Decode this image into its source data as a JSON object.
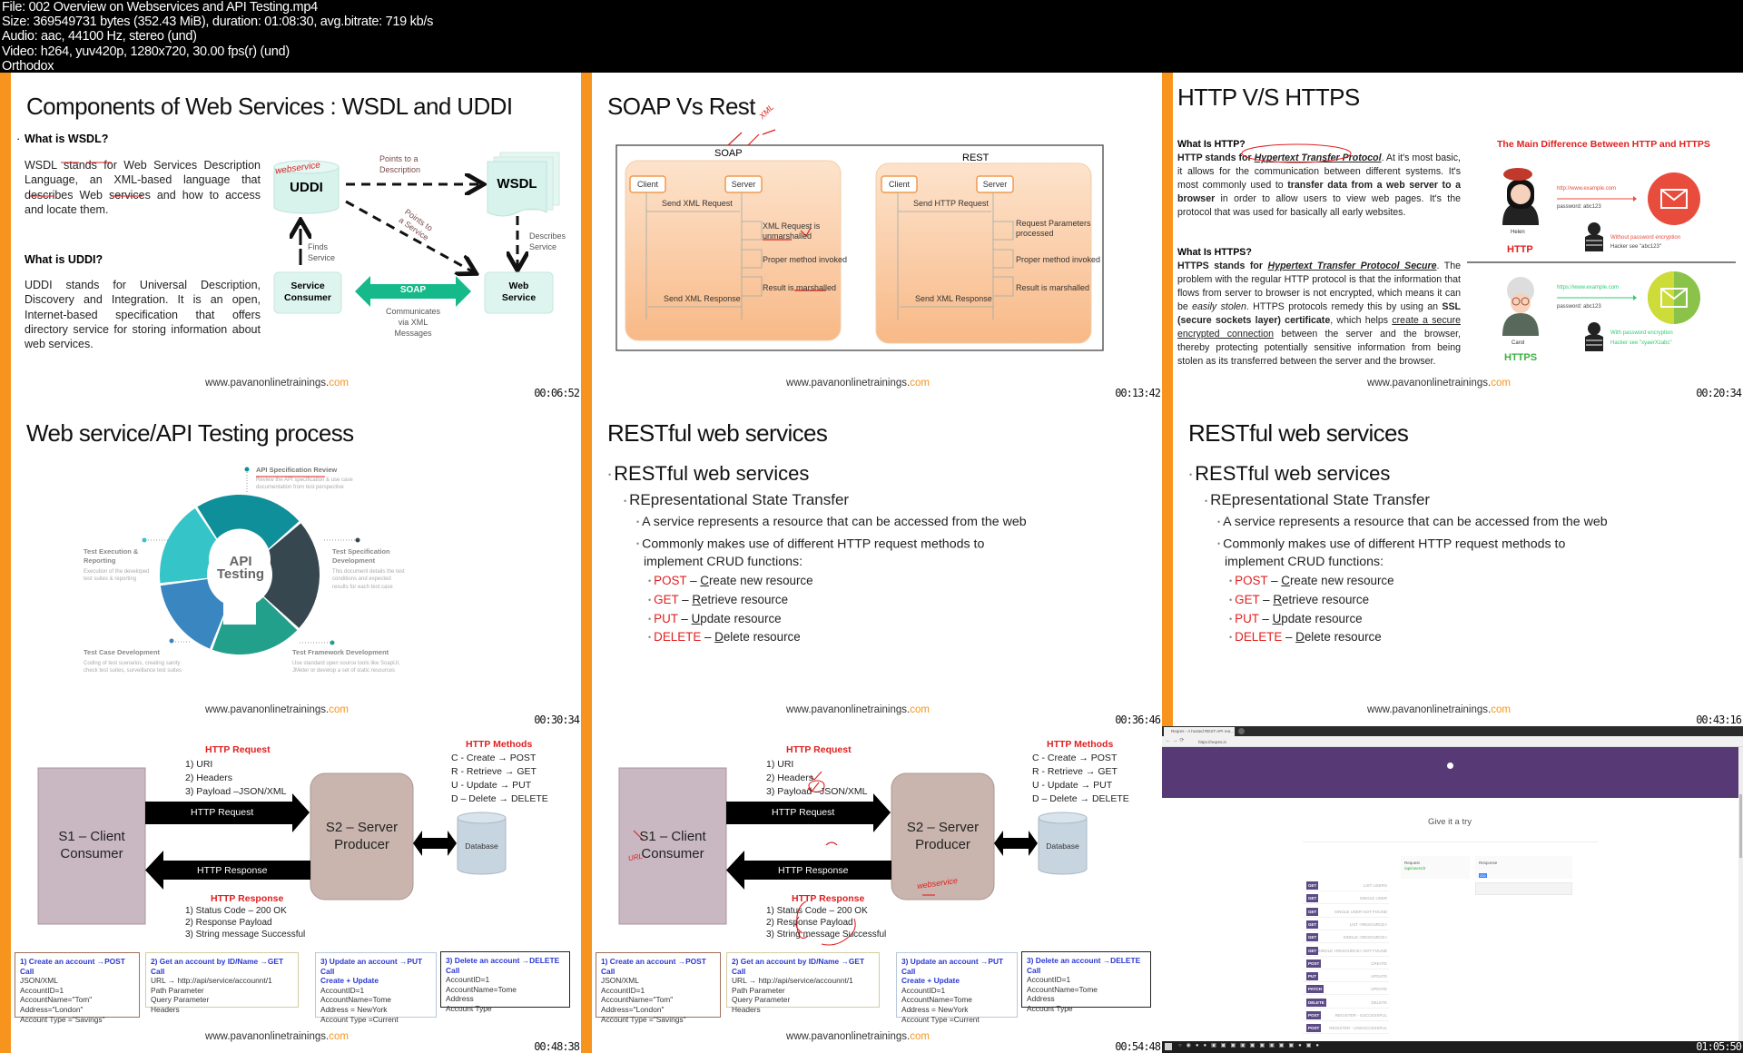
{
  "header": {
    "lines": [
      "File: 002 Overview on Webservices and API Testing.mp4",
      "Size: 369549731 bytes (352.43 MiB), duration: 01:08:30, avg.bitrate: 719 kb/s",
      "Audio: aac, 44100 Hz, stereo (und)",
      "Video: h264, yuv420p, 1280x720, 30.00 fps(r) (und)",
      "Orthodox"
    ]
  },
  "colors": {
    "accent_bar": "#f7941d",
    "method_red": "#e02020",
    "reqres_purple": "#573a75"
  },
  "footer_url": {
    "main": "www.pavanonlinetrainings.",
    "tld": "com"
  },
  "tiles": {
    "wsdl": {
      "timestamp": "00:06:52",
      "title": "Components of Web Services : WSDL and UDDI",
      "q1": "What is WSDL?",
      "a1": "WSDL stands for Web Services Description Language, an XML-based language that describes Web services and how to access and locate them.",
      "q2": "What is UDDI?",
      "a2": "UDDI stands for Universal Description, Discovery and Integration. It is an open, Internet-based specification that offers directory service for storing information about web services.",
      "uddi": "UDDI",
      "wsdl_label": "WSDL",
      "points_desc": [
        "Points to a",
        "Description"
      ],
      "points_service": [
        "Points to",
        "a Service"
      ],
      "finds": [
        "Finds",
        "Service"
      ],
      "describes": [
        "Describes",
        "Service"
      ],
      "consumer": [
        "Service",
        "Consumer"
      ],
      "soap": "SOAP",
      "communicates": [
        "Communicates",
        "via XML",
        "Messages"
      ],
      "web_service": [
        "Web",
        "Service"
      ],
      "handwriting": "webservice"
    },
    "soap_rest": {
      "timestamp": "00:13:42",
      "title": "SOAP Vs Rest",
      "soap": {
        "label": "SOAP",
        "client": "Client",
        "server": "Server",
        "req": "Send XML Request",
        "step1": [
          "XML Request is",
          "unmarshalled"
        ],
        "step2": "Proper method invoked",
        "step3": "Result is marshalled",
        "resp": "Send XML Response"
      },
      "rest": {
        "label": "REST",
        "client": "Client",
        "server": "Server",
        "req": "Send HTTP Request",
        "step1": [
          "Request Parameters",
          "processed"
        ],
        "step2": "Proper method invoked",
        "step3": "Result is marshalled",
        "resp": "Send XML Response"
      },
      "handwriting": "XML"
    },
    "http_https": {
      "timestamp": "00:20:34",
      "title": "HTTP V/S HTTPS",
      "q1": "What Is HTTP?",
      "p1": [
        "HTTP stands for ",
        "Hypertext Transfer Protocol",
        ". At it's most basic, it allows for the communication between different systems. It's most commonly used to ",
        "transfer data from a web server to a browser",
        " in order to allow users to view web pages. It's the protocol that was used for basically all early websites."
      ],
      "q2": "What Is HTTPS?",
      "p2": [
        "HTTPS stands for ",
        "Hypertext Transfer Protocol Secure",
        ". The problem with the regular HTTP protocol is that the information that flows from server to browser is not encrypted, which means it can be ",
        "easily stolen",
        ". HTTPS protocols remedy this by using an ",
        "SSL (secure sockets layer) certificate",
        ", which helps ",
        "create a secure encrypted connection",
        " between the server and the browser, thereby protecting potentially sensitive information from being stolen as its transferred between the server and the browser."
      ],
      "fig_title": "The Main Difference Between HTTP and HTTPS",
      "http": {
        "person": "Helen",
        "label": "HTTP",
        "url": "http://www.example.com",
        "password": "password: abc123",
        "note": "Without password encryption",
        "hacker": "Hacker see \"abc123\""
      },
      "https": {
        "person": "Carol",
        "label": "HTTPS",
        "url": "https://www.example.com",
        "password": "password: abc123",
        "note": "With password encryption",
        "hacker": "Hacker see \"xyaerXzabc\""
      }
    },
    "api_process": {
      "timestamp": "00:30:34",
      "title": "Web service/API Testing process",
      "center": [
        "API",
        "Testing"
      ],
      "steps": [
        {
          "name": "API Specification Review",
          "desc": [
            "Review the API specification & use case",
            "documentation from test perspective"
          ]
        },
        {
          "name": "Test Specification Development",
          "desc": [
            "This document details the test",
            "conditions and expected",
            "results for each test case"
          ]
        },
        {
          "name": "Test Framework Development",
          "desc": [
            "Use standard open source tools like SoapUI,",
            "JMeter or develop a set of static resources"
          ]
        },
        {
          "name": "Test Case Development",
          "desc": [
            "Coding of test scenarios, creating sanity",
            "check test suites, surveillance test suites"
          ]
        },
        {
          "name": "Test Execution & Reporting",
          "desc": [
            "Execution of the developed",
            "test suites & reporting"
          ]
        }
      ],
      "segment_colors": [
        "#0f8f9a",
        "#37474f",
        "#22a08b",
        "#3a86c0",
        "#35c4c8"
      ]
    },
    "restful_1": {
      "timestamp": "00:36:46",
      "title": "RESTful web services",
      "l1": "RESTful web services",
      "l2": "REpresentational State Transfer",
      "l3a": "A service represents a resource that can be accessed from the web",
      "l3b": [
        "Commonly makes use of different HTTP request methods to",
        "implement CRUD functions:"
      ],
      "methods": [
        {
          "method": "POST",
          "desc": "Create new resource"
        },
        {
          "method": "GET",
          "desc": "Retrieve resource"
        },
        {
          "method": "PUT",
          "desc": "Update resource"
        },
        {
          "method": "DELETE",
          "desc": "Delete resource"
        }
      ]
    },
    "restful_2": {
      "timestamp": "00:43:16",
      "title": "RESTful web services",
      "l1": "RESTful web services",
      "l2": "REpresentational State Transfer",
      "l3a": "A service represents a resource that can be accessed from the web",
      "l3b": [
        "Commonly makes use of different HTTP request methods to",
        "implement CRUD functions:"
      ],
      "methods": [
        {
          "method": "POST",
          "desc": "Create new resource"
        },
        {
          "method": "GET",
          "desc": "Retrieve resource"
        },
        {
          "method": "PUT",
          "desc": "Update resource"
        },
        {
          "method": "DELETE",
          "desc": "Delete resource"
        }
      ]
    },
    "http_flow_1": {
      "timestamp": "00:48:38",
      "client": [
        "S1 – Client",
        "Consumer"
      ],
      "server": [
        "S2 – Server",
        "Producer"
      ],
      "req_title": "HTTP Request",
      "req_items": [
        "1) URI",
        "2) Headers",
        "3) Payload –JSON/XML"
      ],
      "req_arrow": "HTTP Request",
      "resp_arrow": "HTTP Response",
      "resp_title": "HTTP Response",
      "resp_items": [
        "1) Status Code – 200 OK",
        "2) Response Payload",
        "3) String message Successful"
      ],
      "methods_title": "HTTP Methods",
      "methods": [
        "C - Create → POST",
        "R  - Retrieve → GET",
        "U - Update → PUT",
        "D – Delete → DELETE"
      ],
      "database": "Database",
      "boxes": [
        {
          "head": [
            "1)  Create an account →POST Call"
          ],
          "lines": [
            "JSON/XML",
            "AccountID=1",
            "AccountName=\"Tom\"",
            "Address=\"London\"",
            "Account Type =\"Savings\""
          ]
        },
        {
          "head": [
            "2)  Get an account by ID/Name →GET Call"
          ],
          "lines": [
            "URL → http://api/service/accounnt/1",
            "Path Parameter",
            "Query Parameter",
            "Headers"
          ]
        },
        {
          "head": [
            "3) Update an account →PUT Call",
            "Create + Update"
          ],
          "lines": [
            "AccountID=1",
            "AccountName=Tome",
            "Address = NewYork",
            "Account Type =Current"
          ]
        },
        {
          "head": [
            "3) Delete an account →DELETE Call"
          ],
          "lines": [
            "AccountID=1",
            "AccountName=Tome",
            "Address",
            "Account Type"
          ]
        }
      ]
    },
    "http_flow_2": {
      "timestamp": "00:54:48",
      "client": [
        "S1 – Client",
        "Consumer"
      ],
      "server": [
        "S2 – Server",
        "Producer"
      ],
      "req_title": "HTTP Request",
      "req_items": [
        "1) URI",
        "2) Headers",
        "3) Payload –JSON/XML"
      ],
      "req_arrow": "HTTP Request",
      "resp_arrow": "HTTP Response",
      "resp_title": "HTTP Response",
      "resp_items": [
        "1) Status Code – 200 OK",
        "2) Response Payload",
        "3) String message Successful"
      ],
      "methods_title": "HTTP Methods",
      "methods": [
        "C - Create → POST",
        "R  - Retrieve → GET",
        "U - Update → PUT",
        "D – Delete → DELETE"
      ],
      "database": "Database",
      "boxes": [
        {
          "head": [
            "1)  Create an account →POST Call"
          ],
          "lines": [
            "JSON/XML",
            "AccountID=1",
            "AccountName=\"Tom\"",
            "Address=\"London\"",
            "Account Type =\"Savings\""
          ]
        },
        {
          "head": [
            "2)  Get an account by ID/Name →GET Call"
          ],
          "lines": [
            "URL → http://api/service/accounnt/1",
            "Path Parameter",
            "Query Parameter",
            "Headers"
          ]
        },
        {
          "head": [
            "3) Update an account →PUT Call",
            "Create + Update"
          ],
          "lines": [
            "AccountID=1",
            "AccountName=Tome",
            "Address = NewYork",
            "Account Type =Current"
          ]
        },
        {
          "head": [
            "3) Delete an account →DELETE Call"
          ],
          "lines": [
            "AccountID=1",
            "AccountName=Tome",
            "Address",
            "Account Type"
          ]
        }
      ],
      "handwriting": [
        "URL",
        "webservice"
      ]
    },
    "reqres": {
      "timestamp": "01:05:50",
      "tab_title": "Reqres - A hosted REST-API rea...",
      "address": "https://reqres.in",
      "heading": "Give it a try",
      "request_label": "Request",
      "request_path": "/api/users/2",
      "response_label": "Response",
      "response_code": "200",
      "endpoints": [
        {
          "method": "GET",
          "label": "LIST USERS"
        },
        {
          "method": "GET",
          "label": "SINGLE USER"
        },
        {
          "method": "GET",
          "label": "SINGLE USER NOT FOUND"
        },
        {
          "method": "GET",
          "label": "LIST <RESOURCE>"
        },
        {
          "method": "GET",
          "label": "SINGLE <RESOURCE>"
        },
        {
          "method": "GET",
          "label": "SINGLE <RESOURCE> NOT FOUND"
        },
        {
          "method": "POST",
          "label": "CREATE"
        },
        {
          "method": "PUT",
          "label": "UPDATE"
        },
        {
          "method": "PATCH",
          "label": "UPDATE"
        },
        {
          "method": "DELETE",
          "label": "DELETE"
        },
        {
          "method": "POST",
          "label": "REGISTER - SUCCESSFUL"
        },
        {
          "method": "POST",
          "label": "REGISTER - UNSUCCESSFUL"
        }
      ]
    }
  }
}
